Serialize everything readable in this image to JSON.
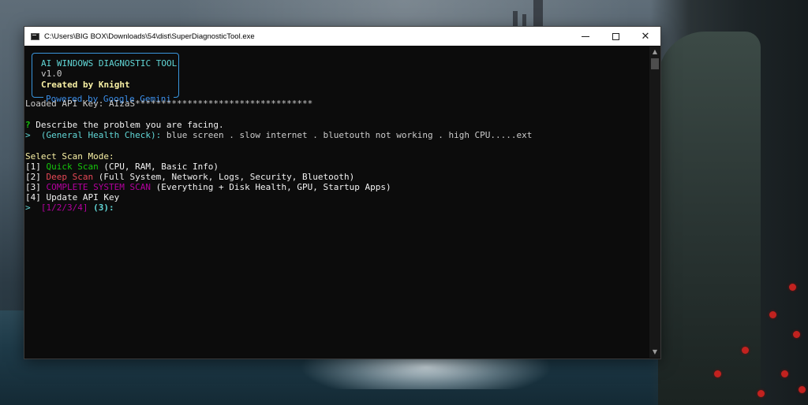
{
  "window": {
    "title": "C:\\Users\\BIG BOX\\Downloads\\54\\dist\\SuperDiagnosticTool.exe",
    "minimize": "—",
    "maximize": "□",
    "close": "✕"
  },
  "banner": {
    "title": "AI WINDOWS DIAGNOSTIC TOOL",
    "version": "v1.0",
    "author": "Created by Knight",
    "powered": "Powered by Google Gemini"
  },
  "console": {
    "api_key_line": "Loaded API Key: AIzaS**********************************",
    "question_mark": "?",
    "question": "Describe the problem you are facing.",
    "prompt_glyph": ">",
    "default_hint": "(General Health Check):",
    "answer": "blue screen . slow internet . bluetouth not working . high CPU.....ext",
    "select_heading": "Select Scan Mode:",
    "options": [
      {
        "key": "[1]",
        "name": "Quick Scan",
        "desc": "(CPU, RAM, Basic Info)",
        "color": "#16c60c"
      },
      {
        "key": "[2]",
        "name": "Deep Scan",
        "desc": "(Full System, Network, Logs, Security, Bluetooth)",
        "color": "#e74856"
      },
      {
        "key": "[3]",
        "name": "COMPLETE SYSTEM SCAN",
        "desc": "(Everything + Disk Health, GPU, Startup Apps)",
        "color": "#b4009e"
      },
      {
        "key": "[4]",
        "name": "Update API Key",
        "desc": "",
        "color": "#f2f2f2"
      }
    ],
    "choice_prompt": "[1/2/3/4]",
    "choice_default": "(3):"
  },
  "colors": {
    "console_bg": "#0c0c0c",
    "cyan": "#61d6d6",
    "green": "#16c60c",
    "red": "#e74856",
    "magenta": "#b4009e",
    "yellow": "#f9f1a5",
    "banner_border": "#3a96dd"
  }
}
